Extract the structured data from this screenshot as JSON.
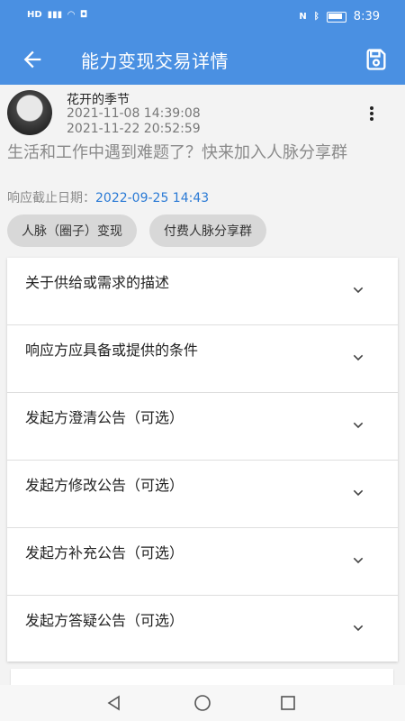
{
  "status": {
    "time": "8:39",
    "left_icons": [
      "hd-icon",
      "signal-icon",
      "wifi-icon",
      "app-icon"
    ],
    "right_icons": [
      "nfc-icon",
      "bluetooth-icon",
      "battery-icon"
    ]
  },
  "appbar": {
    "title": "能力变现交易详情"
  },
  "post": {
    "author": "花开的季节",
    "created": "2021-11-08 14:39:08",
    "updated": "2021-11-22 20:52:59",
    "headline": "生活和工作中遇到难题了？快来加入人脉分享群",
    "deadline_label": "响应截止日期：",
    "deadline_value": "2022-09-25 14:43",
    "tags": [
      "人脉（圈子）变现",
      "付费人脉分享群"
    ]
  },
  "sections": [
    {
      "label": "关于供给或需求的描述"
    },
    {
      "label": "响应方应具备或提供的条件"
    },
    {
      "label": "发起方澄清公告（可选）"
    },
    {
      "label": "发起方修改公告（可选）"
    },
    {
      "label": "发起方补充公告（可选）"
    },
    {
      "label": "发起方答疑公告（可选）"
    }
  ],
  "colors": {
    "primary": "#4a90e2",
    "link": "#2a7ad5"
  }
}
